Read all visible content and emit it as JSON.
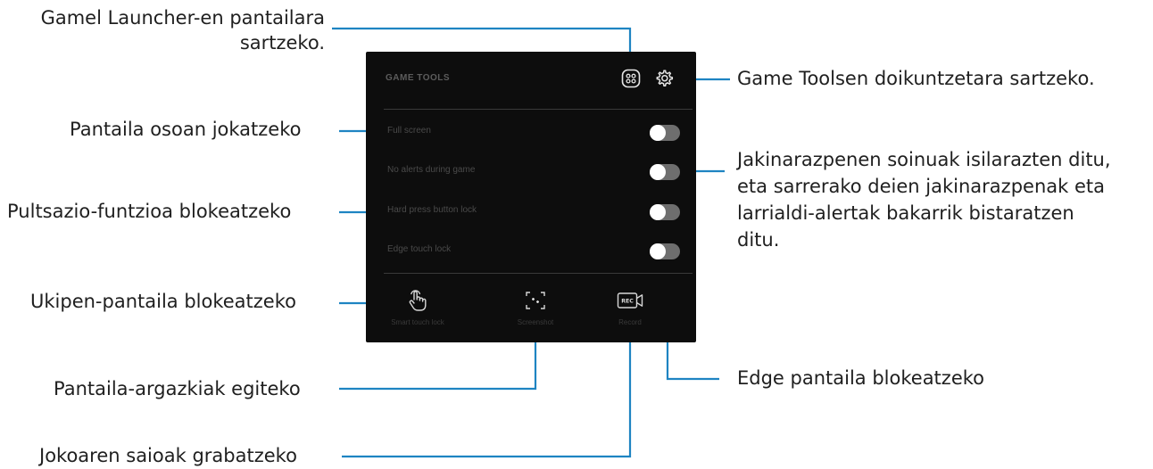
{
  "panel": {
    "title": "GAME TOOLS",
    "header_icons": [
      "game-launcher-icon",
      "gear-icon"
    ],
    "rows": [
      {
        "label": "Full screen",
        "state": "off"
      },
      {
        "label": "No alerts during game",
        "state": "off"
      },
      {
        "label": "Hard press button lock",
        "state": "off"
      },
      {
        "label": "Edge touch lock",
        "state": "off"
      }
    ],
    "tools": [
      {
        "label": "Smart touch lock",
        "icon": "touch-lock-icon"
      },
      {
        "label": "Screenshot",
        "icon": "screenshot-icon"
      },
      {
        "label": "Record",
        "icon": "record-icon"
      }
    ]
  },
  "callouts": {
    "launcher": [
      "Gamel Launcher-en pantailara",
      "sartzeko."
    ],
    "fullscreen": "Pantaila osoan jokatzeko",
    "hardpress": "Pultsazio-funtzioa blokeatzeko",
    "touchlock": "Ukipen-pantaila blokeatzeko",
    "screenshot": "Pantaila-argazkiak egiteko",
    "record": "Jokoaren saioak grabatzeko",
    "settings": "Game Toolsen doikuntzetara sartzeko.",
    "alerts": [
      "Jakinarazpenen soinuak isilarazten ditu,",
      "eta sarrerako deien jakinarazpenak eta",
      "larrialdi-alertak bakarrik bistaratzen",
      "ditu."
    ],
    "edge": "Edge pantaila blokeatzeko"
  },
  "colors": {
    "leader_line": "#1e84c2",
    "panel_bg": "#0d0d0d",
    "callout_text": "#1f1f1f"
  }
}
